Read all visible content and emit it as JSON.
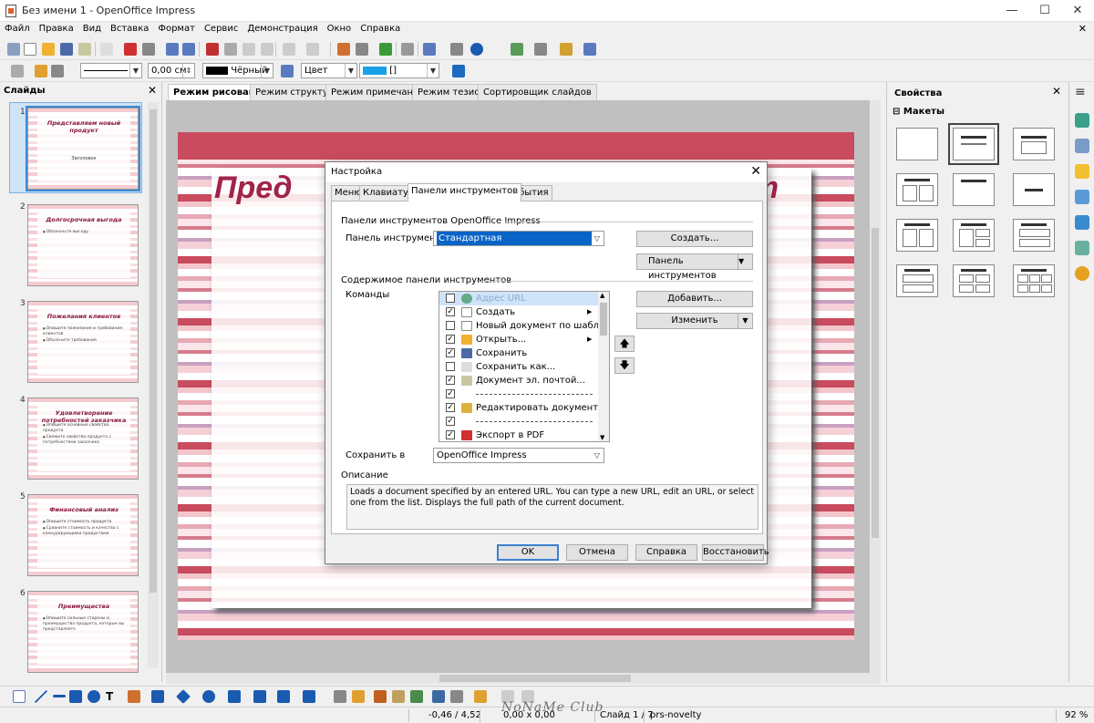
{
  "window": {
    "title": "Без имени 1 - OpenOffice Impress",
    "minimize": "—",
    "maximize": "☐",
    "close": "✕"
  },
  "menu": [
    "Файл",
    "Правка",
    "Вид",
    "Вставка",
    "Формат",
    "Сервис",
    "Демонстрация",
    "Окно",
    "Справка"
  ],
  "menu_close": "✕",
  "line_toolbar": {
    "line_width": "0,00 см",
    "line_color": "Чёрный",
    "area_style": "Цвет",
    "area_color": "[]"
  },
  "slides_pane": {
    "title": "Слайды",
    "close": "✕",
    "slides": [
      {
        "num": "1",
        "title": "Представляем новый продукт",
        "sub": "Заголовок",
        "bullets": []
      },
      {
        "num": "2",
        "title": "Долгосрочная выгода",
        "sub": "",
        "bullets": [
          "Обозначьте выгоду"
        ]
      },
      {
        "num": "3",
        "title": "Пожелания клиентов",
        "sub": "",
        "bullets": [
          "Опишите пожелания и требования клиентов",
          "Объясните требования"
        ]
      },
      {
        "num": "4",
        "title": "Удовлетворение потребностей заказчика",
        "sub": "",
        "bullets": [
          "Опишите основные свойства продукта",
          "Свяжите свойства продукта с потребностями заказчика"
        ]
      },
      {
        "num": "5",
        "title": "Финансовый анализ",
        "sub": "",
        "bullets": [
          "Опишите стоимость продукта",
          "Сравните стоимость и качество с конкурирующими продуктами"
        ]
      },
      {
        "num": "6",
        "title": "Преимущества",
        "sub": "",
        "bullets": [
          "Опишите сильные стороны и преимущества продукта, которые вы представляете"
        ]
      }
    ]
  },
  "view_tabs": [
    "Режим рисования",
    "Режим структуры",
    "Режим примечаний",
    "Режим тезисов",
    "Сортировщик слайдов"
  ],
  "slide_title_left": "Пред",
  "slide_title_right": "ст",
  "properties": {
    "title": "Свойства",
    "close": "✕",
    "section": "Макеты"
  },
  "dialog": {
    "title": "Настройка",
    "close": "✕",
    "tabs": [
      "Меню",
      "Клавиатура",
      "Панели инструментов",
      "События"
    ],
    "group1": "Панели инструментов OpenOffice Impress",
    "toolbar_label": "Панель инструментов",
    "toolbar_value": "Стандартная",
    "btn_create": "Создать...",
    "btn_toolbar": "Панель инструментов",
    "group2": "Содержимое панели инструментов",
    "commands_label": "Команды",
    "commands": [
      {
        "label": "Адрес URL",
        "checked": false,
        "hl": true,
        "sub": false,
        "sep": false,
        "color": "#6a8"
      },
      {
        "label": "Создать",
        "checked": true,
        "hl": false,
        "sub": true,
        "sep": false,
        "color": "#ddd"
      },
      {
        "label": "Новый документ по шаблону",
        "checked": false,
        "hl": false,
        "sub": false,
        "sep": false,
        "color": "#ddd"
      },
      {
        "label": "Открыть...",
        "checked": true,
        "hl": false,
        "sub": true,
        "sep": false,
        "color": "#f0b030"
      },
      {
        "label": "Сохранить",
        "checked": true,
        "hl": false,
        "sub": false,
        "sep": false,
        "color": "#4a6aa8"
      },
      {
        "label": "Сохранить как...",
        "checked": false,
        "hl": false,
        "sub": false,
        "sep": false,
        "color": "#ddd"
      },
      {
        "label": "Документ эл. почтой...",
        "checked": true,
        "hl": false,
        "sub": false,
        "sep": false,
        "color": "#c8c8a0"
      },
      {
        "label": "",
        "checked": true,
        "hl": false,
        "sub": false,
        "sep": true,
        "color": ""
      },
      {
        "label": "Редактировать документ",
        "checked": true,
        "hl": false,
        "sub": false,
        "sep": false,
        "color": "#e0b040"
      },
      {
        "label": "",
        "checked": true,
        "hl": false,
        "sub": false,
        "sep": true,
        "color": ""
      },
      {
        "label": "Экспорт в PDF",
        "checked": true,
        "hl": false,
        "sub": false,
        "sep": false,
        "color": "#d03030"
      }
    ],
    "btn_add": "Добавить...",
    "btn_modify": "Изменить",
    "save_in_label": "Сохранить в",
    "save_in_value": "OpenOffice Impress",
    "description_label": "Описание",
    "description": "Loads a document specified by an entered URL. You can type a new URL, edit an URL, or select one from the list. Displays the full path of the current document.",
    "btn_ok": "OK",
    "btn_cancel": "Отмена",
    "btn_help": "Справка",
    "btn_restore": "Восстановить"
  },
  "status": {
    "position": "-0,46 / 4,52",
    "size": "0,00 x 0,00",
    "slide": "Слайд 1 / 7",
    "theme": "prs-novelty",
    "zoom": "92 %"
  },
  "watermark": "NoNaMe Club"
}
